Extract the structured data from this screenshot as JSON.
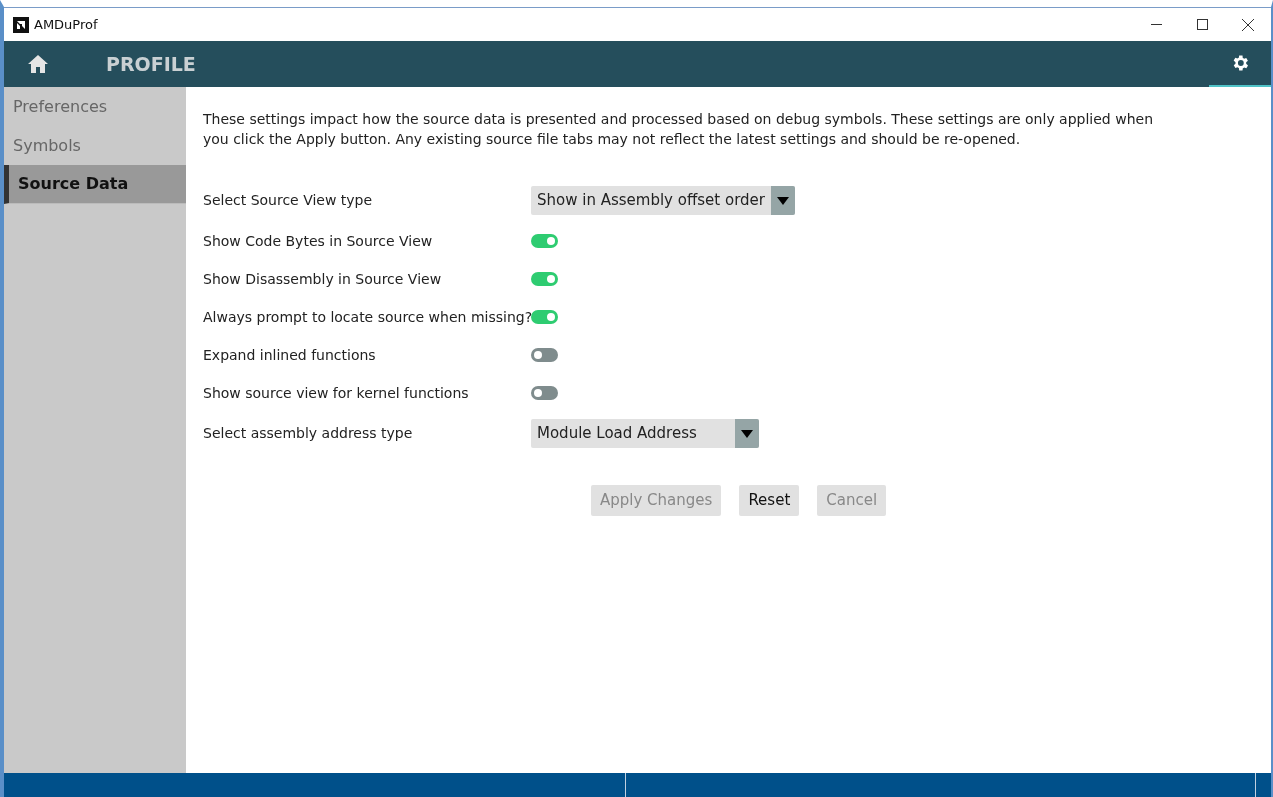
{
  "window": {
    "title": "AMDuProf"
  },
  "header": {
    "title": "PROFILE"
  },
  "sidebar": {
    "items": [
      {
        "label": "Preferences",
        "selected": false
      },
      {
        "label": "Symbols",
        "selected": false
      },
      {
        "label": "Source Data",
        "selected": true
      }
    ]
  },
  "description": "These settings impact how the source data is presented and processed based on debug symbols.  These settings are only applied when you click the Apply button. Any existing source file tabs may not reflect the latest settings and should be re-opened.",
  "settings": [
    {
      "kind": "dropdown",
      "label": "Select Source View type",
      "value": "Show in Assembly offset order"
    },
    {
      "kind": "toggle",
      "label": "Show Code Bytes in Source View",
      "on": true
    },
    {
      "kind": "toggle",
      "label": "Show Disassembly in Source View",
      "on": true
    },
    {
      "kind": "toggle",
      "label": "Always prompt to locate source when missing?",
      "on": true
    },
    {
      "kind": "toggle",
      "label": "Expand inlined functions",
      "on": false
    },
    {
      "kind": "toggle",
      "label": "Show source view for kernel functions",
      "on": false
    },
    {
      "kind": "dropdown",
      "label": "Select assembly address type",
      "value": "Module Load Address"
    }
  ],
  "buttons": [
    {
      "label": "Apply Changes",
      "disabled": true
    },
    {
      "label": "Reset",
      "disabled": false
    },
    {
      "label": "Cancel",
      "disabled": true
    }
  ]
}
